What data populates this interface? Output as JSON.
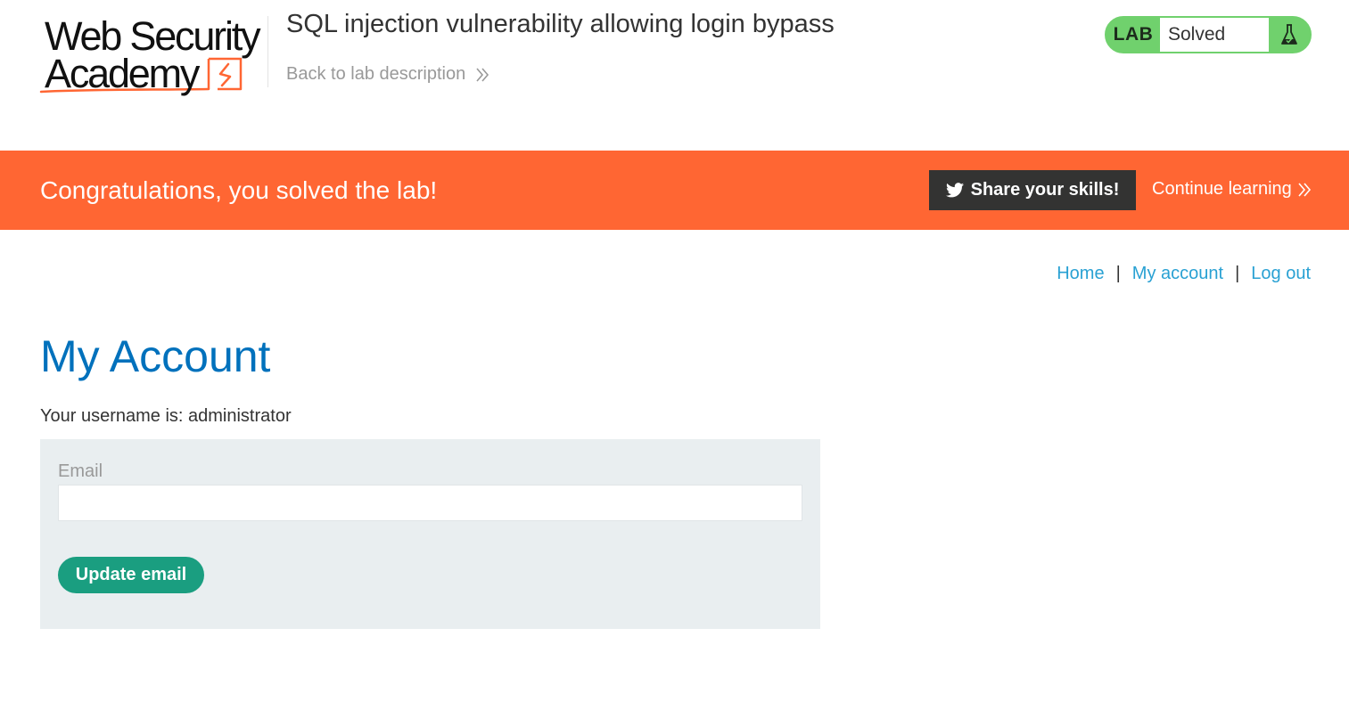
{
  "header": {
    "logo_line1": "Web Security",
    "logo_line2": "Academy",
    "lab_title": "SQL injection vulnerability allowing login bypass",
    "back_link": "Back to lab description",
    "badge": {
      "lab_label": "LAB",
      "status": "Solved",
      "icon": "flask-icon"
    }
  },
  "banner": {
    "message": "Congratulations, you solved the lab!",
    "share_button": "Share your skills!",
    "share_icon": "twitter-icon",
    "continue_link": "Continue learning"
  },
  "nav": {
    "home": "Home",
    "separator": "|",
    "my_account": "My account",
    "log_out": "Log out"
  },
  "main": {
    "title": "My Account",
    "username_line": "Your username is: administrator",
    "email_form": {
      "label": "Email",
      "value": "",
      "submit_label": "Update email"
    }
  },
  "colors": {
    "banner_orange": "#ff6633",
    "badge_green": "#70d16d",
    "link_blue": "#29a1d3",
    "title_blue": "#0071bc",
    "button_teal": "#1a9e80",
    "share_dark": "#333332",
    "form_bg": "#e9eef0",
    "logo_accent": "#ff6633"
  }
}
